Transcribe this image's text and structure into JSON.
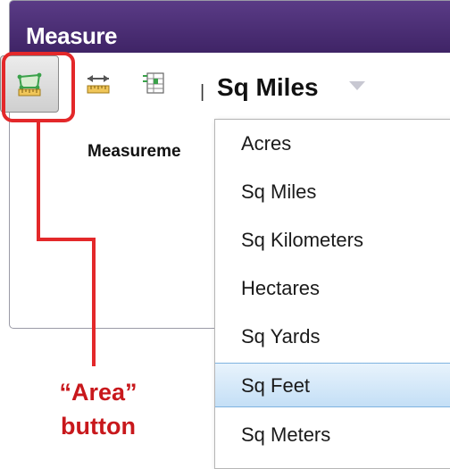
{
  "panel": {
    "title": "Measure",
    "measurement_label": "Measureme",
    "units_selected": "Sq Miles",
    "separator": "|"
  },
  "tools": [
    {
      "name": "area-tool",
      "icon": "area-measure-icon",
      "active": true
    },
    {
      "name": "distance-tool",
      "icon": "distance-measure-icon",
      "active": false
    },
    {
      "name": "location-tool",
      "icon": "location-measure-icon",
      "active": false
    }
  ],
  "units_menu": {
    "items": [
      "Acres",
      "Sq Miles",
      "Sq Kilometers",
      "Hectares",
      "Sq Yards",
      "Sq Feet",
      "Sq Meters"
    ],
    "highlighted": "Sq Feet"
  },
  "annotation": {
    "line1": "“Area”",
    "line2": "button",
    "color": "#e3282a"
  },
  "colors": {
    "titlebar": "#4b2c76",
    "highlight": "#e3282a",
    "menu_hover": "#c4dff6"
  }
}
